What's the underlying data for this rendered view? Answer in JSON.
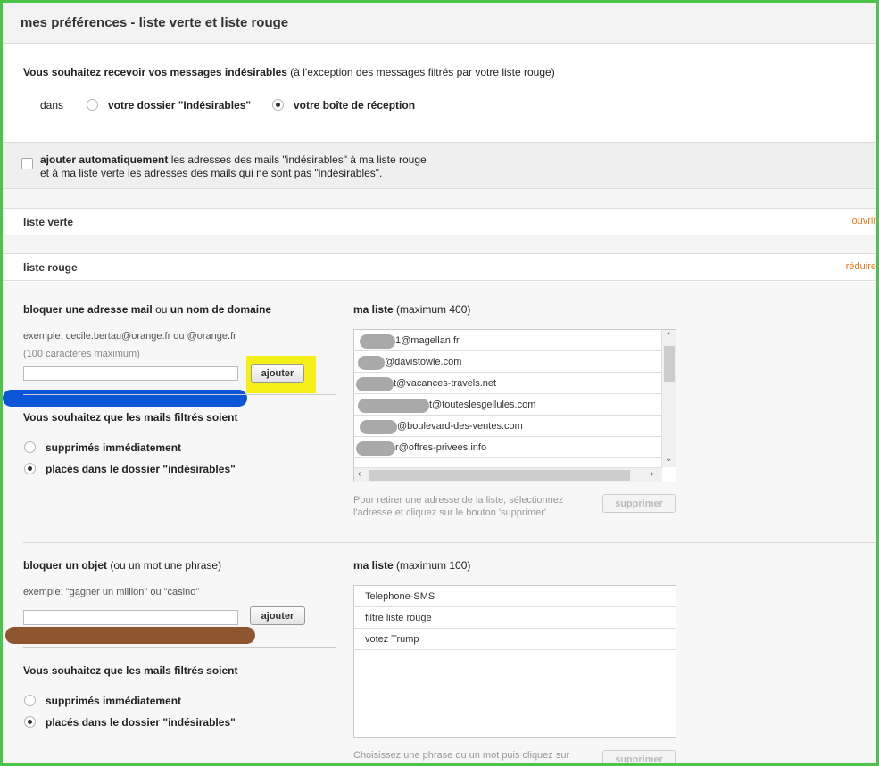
{
  "header": {
    "title": "mes préférences - liste verte et liste rouge"
  },
  "spam_pref": {
    "question_bold": "Vous souhaitez recevoir vos messages indésirables",
    "question_rest": "(à l'exception des messages filtrés par votre liste rouge)",
    "dans": "dans",
    "option1": "votre dossier \"Indésirables\"",
    "option2": "votre boîte de réception",
    "selected": 2
  },
  "auto_add": {
    "bold": "ajouter automatiquement",
    "line1_rest": "les adresses des mails \"indésirables\" à ma liste rouge",
    "line2": "et à ma liste verte les adresses des mails qui ne sont pas \"indésirables\".",
    "checked": false
  },
  "sections": {
    "verte": {
      "label": "liste verte",
      "action": "ouvrir"
    },
    "rouge": {
      "label": "liste rouge",
      "action": "réduire"
    }
  },
  "block_address": {
    "title_bold1": "bloquer une adresse mail",
    "title_ou": "ou",
    "title_bold2": "un nom de domaine",
    "example": "exemple: cecile.bertau@orange.fr ou @orange.fr",
    "limit": "(100 caractères maximum)",
    "input_value": "",
    "add_label": "ajouter",
    "list_title": "ma liste",
    "list_max": "(maximum 400)",
    "items": [
      "1@magellan.fr",
      "@davistowle.com",
      "t@vacances-travels.net",
      "t@touteslesgellules.com",
      "@boulevard-des-ventes.com",
      "r@offres-privees.info"
    ],
    "help": "Pour retirer une adresse de la liste, sélectionnez l'adresse et cliquez sur le bouton 'supprimer'",
    "help_line1": "Pour retirer une adresse de la liste, sélectionnez",
    "help_line2": "l'adresse et cliquez sur le bouton 'supprimer'",
    "delete_label": "supprimer",
    "filtered_title": "Vous souhaitez que les mails filtrés soient",
    "opt_delete": "supprimés immédiatement",
    "opt_folder": "placés dans le dossier \"indésirables\"",
    "selected": 2
  },
  "block_subject": {
    "title_bold": "bloquer un objet",
    "title_rest": "(ou un mot une phrase)",
    "example": "exemple: \"gagner un million\" ou \"casino\"",
    "input_value": "",
    "add_label": "ajouter",
    "list_title": "ma liste",
    "list_max": "(maximum 100)",
    "items": [
      "Telephone-SMS",
      "filtre liste rouge",
      "votez Trump"
    ],
    "help": "Choisissez une phrase ou un mot puis cliquez sur",
    "delete_label": "supprimer",
    "filtered_title": "Vous souhaitez que les mails filtrés soient",
    "opt_delete": "supprimés immédiatement",
    "opt_folder": "placés dans le dossier \"indésirables\"",
    "selected": 2
  },
  "colors": {
    "frame": "#4cc44c",
    "highlight": "#f5ef17",
    "redact_blue": "#0a55d8",
    "redact_brown": "#8e5531",
    "action_orange": "#e67a1e"
  }
}
